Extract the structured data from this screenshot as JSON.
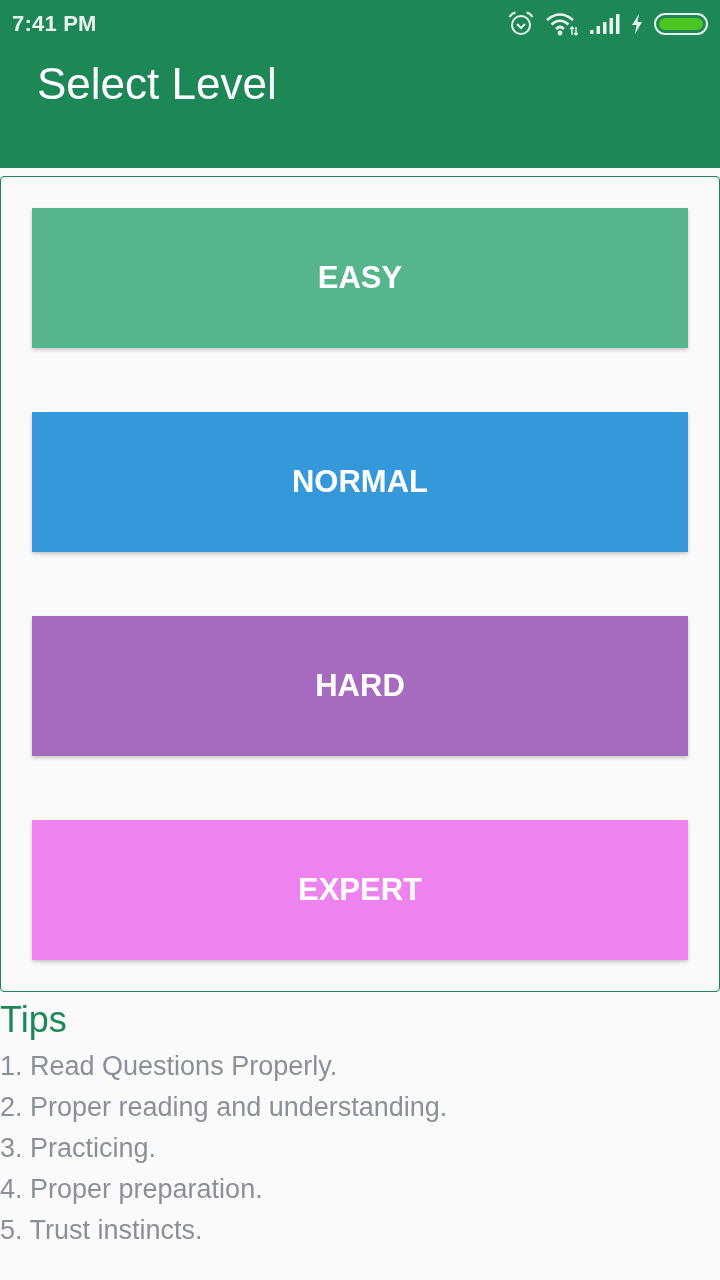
{
  "status_bar": {
    "time": "7:41 PM"
  },
  "app_bar": {
    "title": "Select Level"
  },
  "levels": [
    {
      "label": "EASY",
      "color": "#57b58c"
    },
    {
      "label": "NORMAL",
      "color": "#3498db"
    },
    {
      "label": "HARD",
      "color": "#a66bbe"
    },
    {
      "label": "EXPERT",
      "color": "#ee82ee"
    }
  ],
  "tips": {
    "title": "Tips",
    "items": [
      "1. Read Questions Properly.",
      "2. Proper reading and understanding.",
      "3. Practicing.",
      "4. Proper preparation.",
      "5. Trust instincts."
    ]
  }
}
